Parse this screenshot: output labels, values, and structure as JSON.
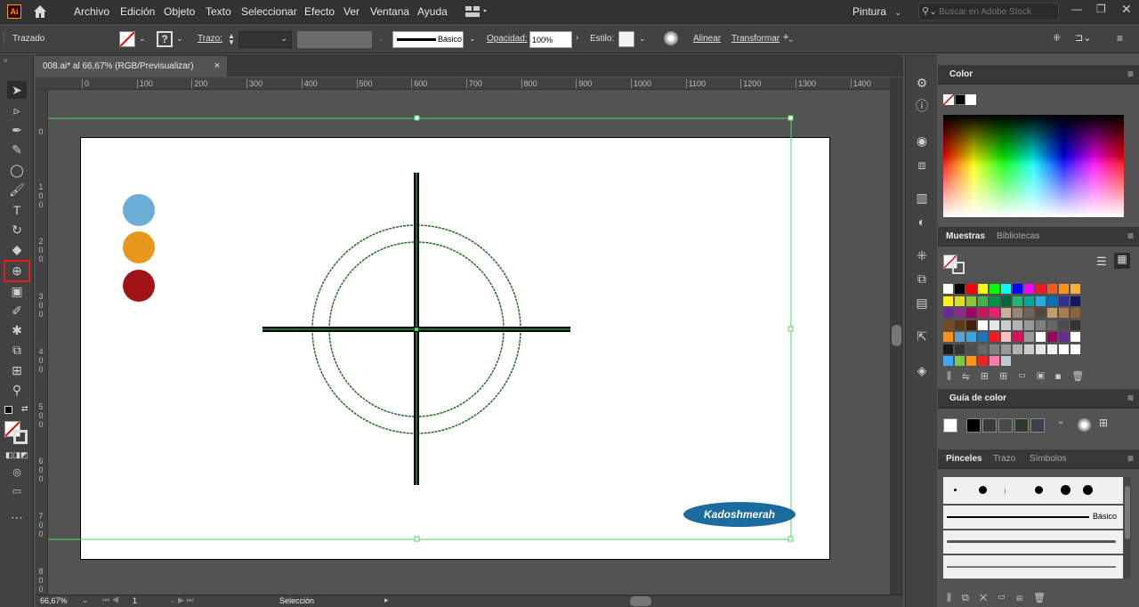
{
  "app": {
    "logo": "Ai"
  },
  "menu": [
    "Archivo",
    "Edición",
    "Objeto",
    "Texto",
    "Seleccionar",
    "Efecto",
    "Ver",
    "Ventana",
    "Ayuda"
  ],
  "workspace": "Pintura",
  "search_placeholder": "Buscar en Adobe Stock",
  "control": {
    "object_type": "Trazado",
    "stroke_label": "Trazo:",
    "brush_preset": "Básico",
    "opacity_label": "Opacidad:",
    "opacity_value": "100%",
    "style_label": "Estilo:",
    "align_label": "Alinear",
    "transform_label": "Transformar"
  },
  "document_tab": {
    "title": "008.ai* al 66,67% (RGB/Previsualizar)",
    "close": "×"
  },
  "ruler_h": [
    "0",
    "100",
    "200",
    "300",
    "400",
    "500",
    "600",
    "700",
    "800",
    "900",
    "1000",
    "1100",
    "1200",
    "1300",
    "1400"
  ],
  "ruler_v": [
    "0",
    "1\n0\n0",
    "2\n0\n0",
    "3\n0\n0",
    "4\n0\n0",
    "5\n0\n0",
    "6\n0\n0",
    "7\n0\n0",
    "8\n0\n0"
  ],
  "artwork": {
    "swatch_colors": [
      "#6aaed6",
      "#e8981a",
      "#a01418"
    ],
    "crosshair_color": "#000000",
    "selection_color": "#4cd964",
    "badge_text": "Kadoshmerah",
    "badge_color": "#1b6c9c"
  },
  "status": {
    "zoom": "66,67%",
    "artboard": "1",
    "tool": "Selección"
  },
  "panels": {
    "color": {
      "title": "Color"
    },
    "swatches": {
      "tabs": [
        "Muestras",
        "Bibliotecas"
      ]
    },
    "color_guide": {
      "title": "Guía de color"
    },
    "brushes": {
      "tabs": [
        "Pinceles",
        "Trazo",
        "Símbolos"
      ],
      "basic_label": "Básico"
    }
  },
  "swatch_grid": [
    [
      "#ffffff",
      "#000000",
      "#ff0000",
      "#ffff00",
      "#00ff00",
      "#00ffff",
      "#0000ff",
      "#ff00ff",
      "#ed1c24",
      "#f15a24",
      "#f7931e",
      "#fbb03b"
    ],
    [
      "#fcee21",
      "#d9e021",
      "#8cc63f",
      "#39b54a",
      "#009245",
      "#006837",
      "#22b573",
      "#00a99d",
      "#29abe2",
      "#0071bc",
      "#2e3192",
      "#1b1464"
    ],
    [
      "#662d91",
      "#93278f",
      "#9e005d",
      "#d4145a",
      "#ed1e79",
      "#c7b299",
      "#998675",
      "#736357",
      "#534741",
      "#c69c6d",
      "#a67c52",
      "#8c6239"
    ],
    [
      "#754c24",
      "#603813",
      "#42210b",
      "#ffffff",
      "#e6e6e6",
      "#cccccc",
      "#b3b3b3",
      "#999999",
      "#808080",
      "#666666",
      "#4d4d4d",
      "#333333"
    ],
    [
      "#f7931e",
      "#5e9fd6",
      "#41a2d6",
      "#1b75bb",
      "#ed1c24",
      "#f4c2c2",
      "#d4145a",
      "#999999",
      "#ffffff",
      "#9e005d",
      "#662d91",
      "#ffffff"
    ],
    [
      "#1a1a1a",
      "#333333",
      "#4d4d4d",
      "#666666",
      "#808080",
      "#999999",
      "#b3b3b3",
      "#cccccc",
      "#e6e6e6",
      "#f2f2f2",
      "#ffffff",
      "#ffffff"
    ],
    [
      "#3fa9f5",
      "#7ac943",
      "#ff931e",
      "#ff1d25",
      "#ff7bac",
      "#bdccd4"
    ]
  ],
  "guide_colors": [
    "#ffffff",
    "#000000",
    "#3a3a3a",
    "#4a4a4a",
    "#2f3a2f",
    "#3a3f4a"
  ]
}
